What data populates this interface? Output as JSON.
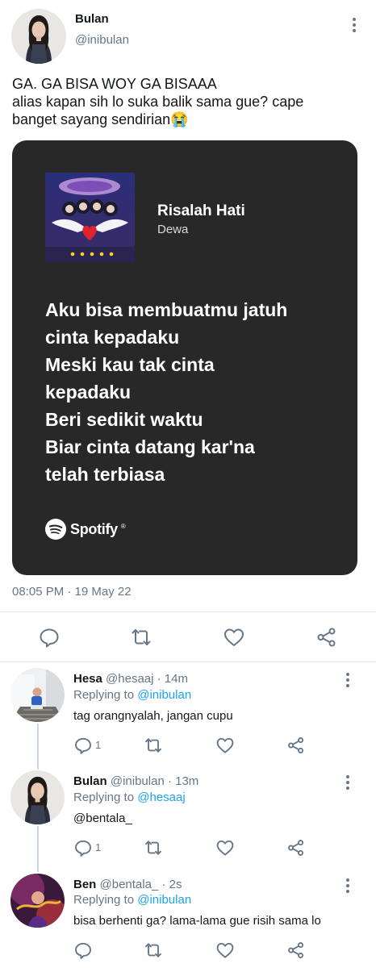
{
  "main_tweet": {
    "name": "Bulan",
    "handle": "@inibulan",
    "text_lines": [
      "GA. GA BISA WOY GA BISAAA",
      "alias kapan sih lo suka balik sama gue? cape",
      "banget sayang sendirian😭"
    ],
    "card": {
      "song_title": "Risalah Hati",
      "artist": "Dewa",
      "lyrics": [
        "Aku bisa membuatmu jatuh",
        "cinta kepadaku",
        "Meski kau tak cinta",
        "kepadaku",
        "Beri sedikit waktu",
        "Biar cinta datang kar'na",
        "telah terbiasa"
      ],
      "brand": "Spotify",
      "brand_mark": "®",
      "background": "#282828"
    },
    "timestamp": "08:05 PM · 19 May 22"
  },
  "replies": [
    {
      "name": "Hesa",
      "meta": "@hesaaj · 14m",
      "replying_prefix": "Replying to ",
      "replying_to": "@inibulan",
      "text": "tag orangnyalah, jangan cupu",
      "reply_count": "1"
    },
    {
      "name": "Bulan",
      "meta": "@inibulan · 13m",
      "replying_prefix": "Replying to ",
      "replying_to": "@hesaaj",
      "text": "@bentala_",
      "reply_count": "1"
    },
    {
      "name": "Ben",
      "meta": "@bentala_ · 2s",
      "replying_prefix": "Replying to ",
      "replying_to": "@inibulan",
      "text": "bisa berhenti ga? lama-lama gue risih sama lo",
      "reply_count": ""
    }
  ],
  "icons": {
    "reply": "reply-icon",
    "retweet": "retweet-icon",
    "like": "heart-icon",
    "share": "share-icon",
    "more": "more-icon"
  },
  "colors": {
    "link": "#1da1f2",
    "secondary_text": "#657786",
    "card_bg": "#282828",
    "icon": "#657786"
  }
}
